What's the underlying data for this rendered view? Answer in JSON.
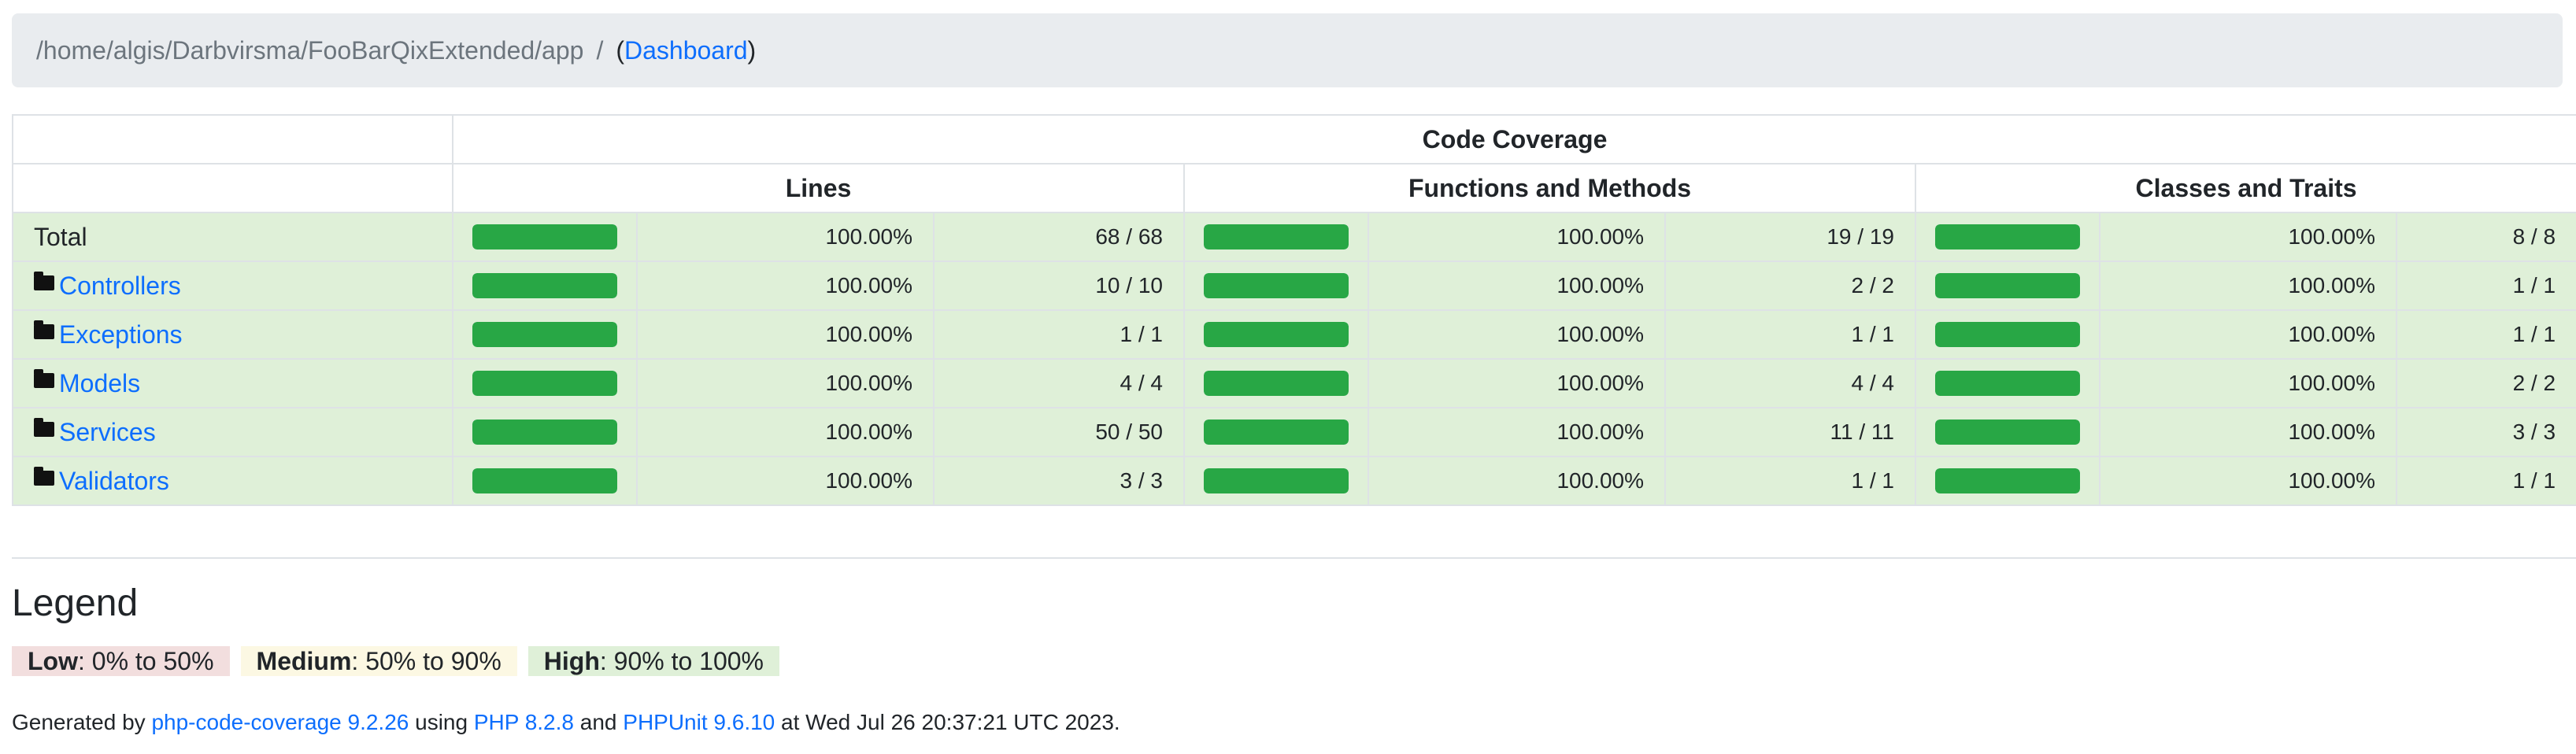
{
  "breadcrumb": {
    "path": "/home/algis/Darbvirsma/FooBarQixExtended/app",
    "separator": "/",
    "open_paren": "(",
    "link": "Dashboard",
    "close_paren": ")"
  },
  "table": {
    "header_title": "Code Coverage",
    "group_headers": {
      "lines": "Lines",
      "functions": "Functions and Methods",
      "classes": "Classes and Traits"
    },
    "rows": [
      {
        "name": "Total",
        "is_link": false,
        "lines": {
          "coverage": 1.0,
          "pct": "100.00%",
          "count": "68 / 68"
        },
        "functions": {
          "coverage": 1.0,
          "pct": "100.00%",
          "count": "19 / 19"
        },
        "classes": {
          "coverage": 1.0,
          "pct": "100.00%",
          "count": "8 / 8"
        }
      },
      {
        "name": "Controllers",
        "is_link": true,
        "icon": "folder-icon",
        "lines": {
          "coverage": 1.0,
          "pct": "100.00%",
          "count": "10 / 10"
        },
        "functions": {
          "coverage": 1.0,
          "pct": "100.00%",
          "count": "2 / 2"
        },
        "classes": {
          "coverage": 1.0,
          "pct": "100.00%",
          "count": "1 / 1"
        }
      },
      {
        "name": "Exceptions",
        "is_link": true,
        "icon": "folder-icon",
        "lines": {
          "coverage": 1.0,
          "pct": "100.00%",
          "count": "1 / 1"
        },
        "functions": {
          "coverage": 1.0,
          "pct": "100.00%",
          "count": "1 / 1"
        },
        "classes": {
          "coverage": 1.0,
          "pct": "100.00%",
          "count": "1 / 1"
        }
      },
      {
        "name": "Models",
        "is_link": true,
        "icon": "folder-icon",
        "lines": {
          "coverage": 1.0,
          "pct": "100.00%",
          "count": "4 / 4"
        },
        "functions": {
          "coverage": 1.0,
          "pct": "100.00%",
          "count": "4 / 4"
        },
        "classes": {
          "coverage": 1.0,
          "pct": "100.00%",
          "count": "2 / 2"
        }
      },
      {
        "name": "Services",
        "is_link": true,
        "icon": "folder-icon",
        "lines": {
          "coverage": 1.0,
          "pct": "100.00%",
          "count": "50 / 50"
        },
        "functions": {
          "coverage": 1.0,
          "pct": "100.00%",
          "count": "11 / 11"
        },
        "classes": {
          "coverage": 1.0,
          "pct": "100.00%",
          "count": "3 / 3"
        }
      },
      {
        "name": "Validators",
        "is_link": true,
        "icon": "folder-icon",
        "lines": {
          "coverage": 1.0,
          "pct": "100.00%",
          "count": "3 / 3"
        },
        "functions": {
          "coverage": 1.0,
          "pct": "100.00%",
          "count": "1 / 1"
        },
        "classes": {
          "coverage": 1.0,
          "pct": "100.00%",
          "count": "1 / 1"
        }
      }
    ]
  },
  "legend": {
    "title": "Legend",
    "low": {
      "label": "Low",
      "range": ": 0% to 50%"
    },
    "medium": {
      "label": "Medium",
      "range": ": 50% to 90%"
    },
    "high": {
      "label": "High",
      "range": ": 90% to 100%"
    }
  },
  "footer": {
    "prefix": "Generated by ",
    "tool_link": "php-code-coverage 9.2.26",
    "using": " using ",
    "php_link": "PHP 8.2.8",
    "and": " and ",
    "phpunit_link": "PHPUnit 9.6.10",
    "suffix": " at Wed Jul 26 20:37:21 UTC 2023."
  },
  "colors": {
    "success_bar": "#28a745",
    "high_bg": "#dff0d8",
    "medium_bg": "#fcf8e3",
    "low_bg": "#f2dede",
    "link": "#0d6efd",
    "breadcrumb_bg": "#e9ecef"
  }
}
